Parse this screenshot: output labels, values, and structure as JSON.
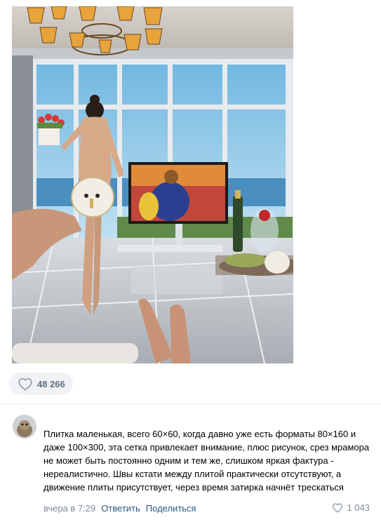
{
  "post": {
    "likes_count": "48 266",
    "like_icon": "heart-outline-icon"
  },
  "comment": {
    "text": "Плитка маленькая, всего 60×60, когда давно уже есть форматы 80×160 и даже 100×300, эта сетка привлекает внимание, плюс рисунок, срез мрамора не может быть постоянно одним и тем же, слишком яркая фактура - нереалистично. Швы кстати между плитой практически отсутствуют, а движение плиты присутствует, через время затирка начнёт трескаться",
    "timestamp": "вчера в 7:29",
    "reply_label": "Ответить",
    "share_label": "Поделиться",
    "likes_count": "1 043"
  },
  "colors": {
    "accent_link": "#2a5885",
    "muted_text": "#818c99",
    "pill_bg": "#f0f2f5"
  }
}
